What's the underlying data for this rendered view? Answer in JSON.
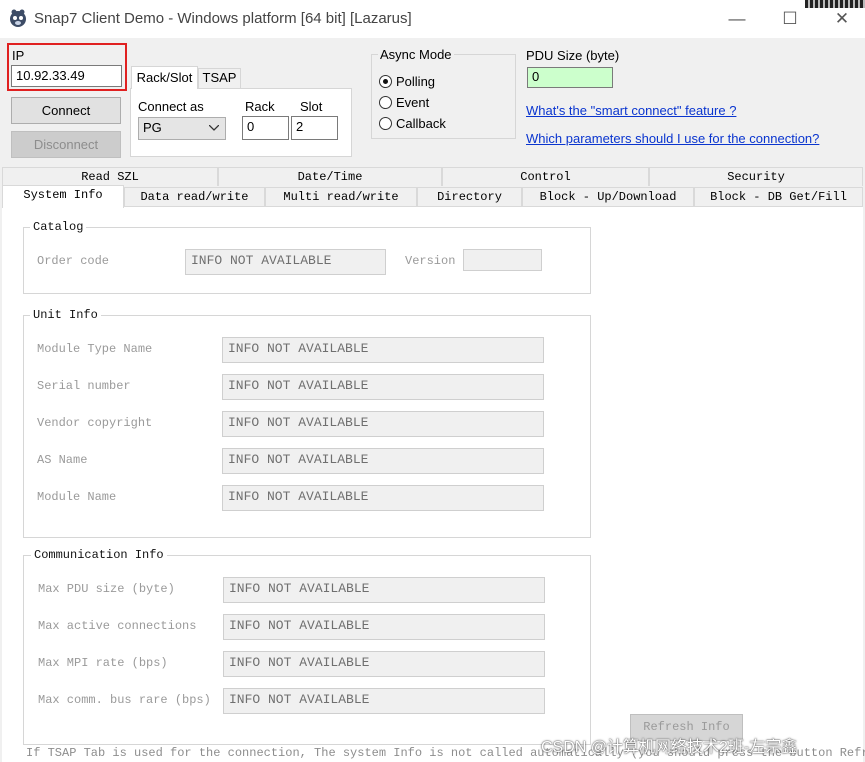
{
  "window": {
    "title": "Snap7 Client Demo - Windows platform [64 bit] [Lazarus]",
    "minimize_glyph": "—",
    "maximize_glyph": "☐",
    "close_glyph": "✕"
  },
  "connection": {
    "ip_label": "IP",
    "ip_value": "10.92.33.49",
    "connect_label": "Connect",
    "disconnect_label": "Disconnect",
    "tabs": [
      "Rack/Slot",
      "TSAP"
    ],
    "connect_as_label": "Connect as",
    "connect_as_value": "PG",
    "rack_label": "Rack",
    "rack_value": "0",
    "slot_label": "Slot",
    "slot_value": "2"
  },
  "async_mode": {
    "title": "Async Mode",
    "options": [
      "Polling",
      "Event",
      "Callback"
    ],
    "selected": "Polling"
  },
  "pdu": {
    "label": "PDU Size (byte)",
    "value": "0",
    "link1": "What's the \"smart connect\" feature ?",
    "link2": "Which parameters should I use for the connection?"
  },
  "tabs_top": [
    "Read SZL",
    "Date/Time",
    "Control",
    "Security"
  ],
  "tabs_bottom": [
    "System Info",
    "Data read/write",
    "Multi read/write",
    "Directory",
    "Block - Up/Download",
    "Block - DB Get/Fill"
  ],
  "catalog": {
    "title": "Catalog",
    "order_code_label": "Order code",
    "order_code_value": "INFO NOT AVAILABLE",
    "version_label": "Version",
    "version_value": ""
  },
  "unit_info": {
    "title": "Unit Info",
    "rows": [
      {
        "label": "Module Type Name",
        "value": "INFO NOT AVAILABLE"
      },
      {
        "label": "Serial number",
        "value": "INFO NOT AVAILABLE"
      },
      {
        "label": "Vendor copyright",
        "value": "INFO NOT AVAILABLE"
      },
      {
        "label": "AS Name",
        "value": "INFO NOT AVAILABLE"
      },
      {
        "label": "Module Name",
        "value": "INFO NOT AVAILABLE"
      }
    ]
  },
  "comm_info": {
    "title": "Communication Info",
    "rows": [
      {
        "label": "Max PDU size (byte)",
        "value": "INFO NOT AVAILABLE"
      },
      {
        "label": "Max active connections",
        "value": "INFO NOT AVAILABLE"
      },
      {
        "label": "Max MPI rate (bps)",
        "value": "INFO NOT AVAILABLE"
      },
      {
        "label": "Max comm. bus rare (bps)",
        "value": "INFO NOT AVAILABLE"
      }
    ]
  },
  "refresh_label": "Refresh Info",
  "footer_note": "If TSAP Tab is used for the connection, The system Info is not called automatically (you should press the button  Refresh",
  "watermark": "CSDN @计算机网络技术2班-左宗鑫"
}
